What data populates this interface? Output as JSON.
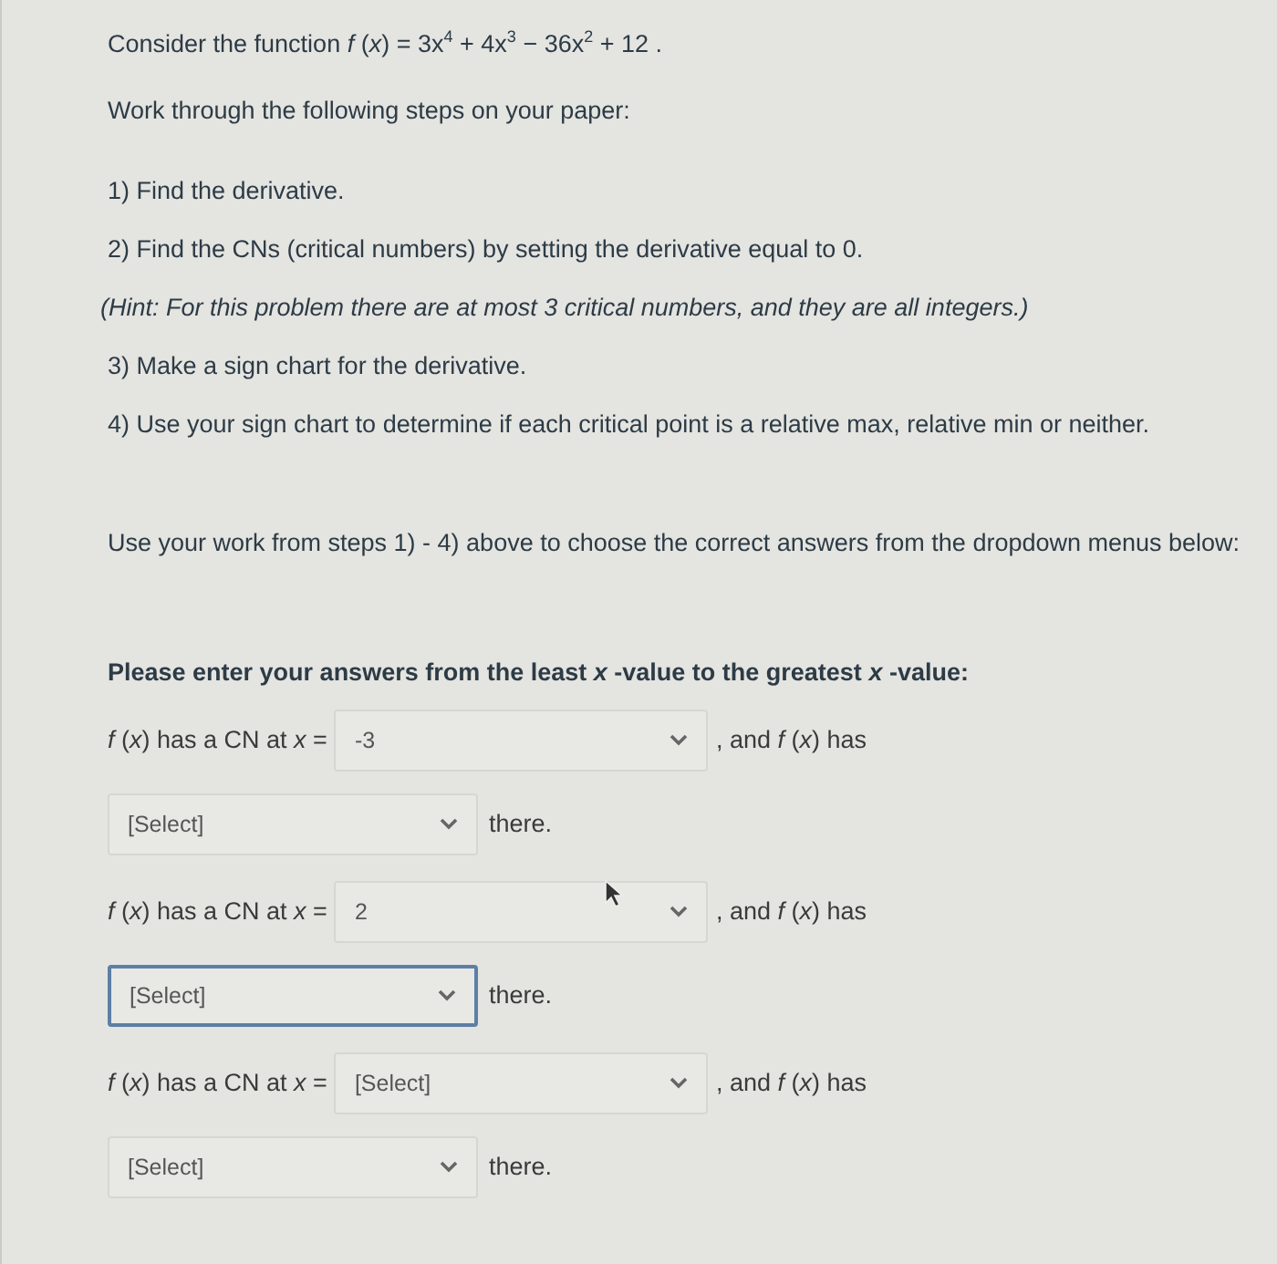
{
  "function_line": "Consider the function *f* (*x*) = 3x$^{4}$ + 4x$^{3}$ − 36x$^{2}$ + 12 .",
  "work_line": "Work through the following steps on your paper:",
  "steps": [
    {
      "kind": "step",
      "text": "1) Find the derivative."
    },
    {
      "kind": "step",
      "text": "2) Find the CNs (critical numbers) by setting the derivative equal to 0."
    },
    {
      "kind": "hint",
      "text": "(Hint: For this problem there are at most 3 critical numbers, and they are all integers.)"
    },
    {
      "kind": "step",
      "text": "3) Make a sign chart for the derivative."
    },
    {
      "kind": "step",
      "text": "4) Use your sign chart to determine if each critical point is a relative max, relative min or neither."
    }
  ],
  "instruction": "Use your work from steps 1) - 4) above to choose the correct answers from the dropdown menus below:",
  "prompt": "Please enter your answers from the least *x* -value to the greatest *x* -value:",
  "answers": [
    {
      "label": "*f* (*x*) has a CN at *x* =",
      "cn_select": {
        "value": "-3",
        "focused": false
      },
      "mid_text": ", and *f* (*x*) has",
      "type_select": {
        "value": "[Select]",
        "focused": false
      },
      "tail": "there."
    },
    {
      "label": "*f* (*x*) has a CN at *x* =",
      "cn_select": {
        "value": "2",
        "focused": false
      },
      "mid_text": ", and *f* (*x*) has",
      "type_select": {
        "value": "[Select]",
        "focused": true
      },
      "tail": "there."
    },
    {
      "label": "*f* (*x*) has a CN at *x* =",
      "cn_select": {
        "value": "[Select]",
        "focused": false
      },
      "mid_text": ", and *f* (*x*) has",
      "type_select": {
        "value": "[Select]",
        "focused": false
      },
      "tail": "there."
    }
  ]
}
